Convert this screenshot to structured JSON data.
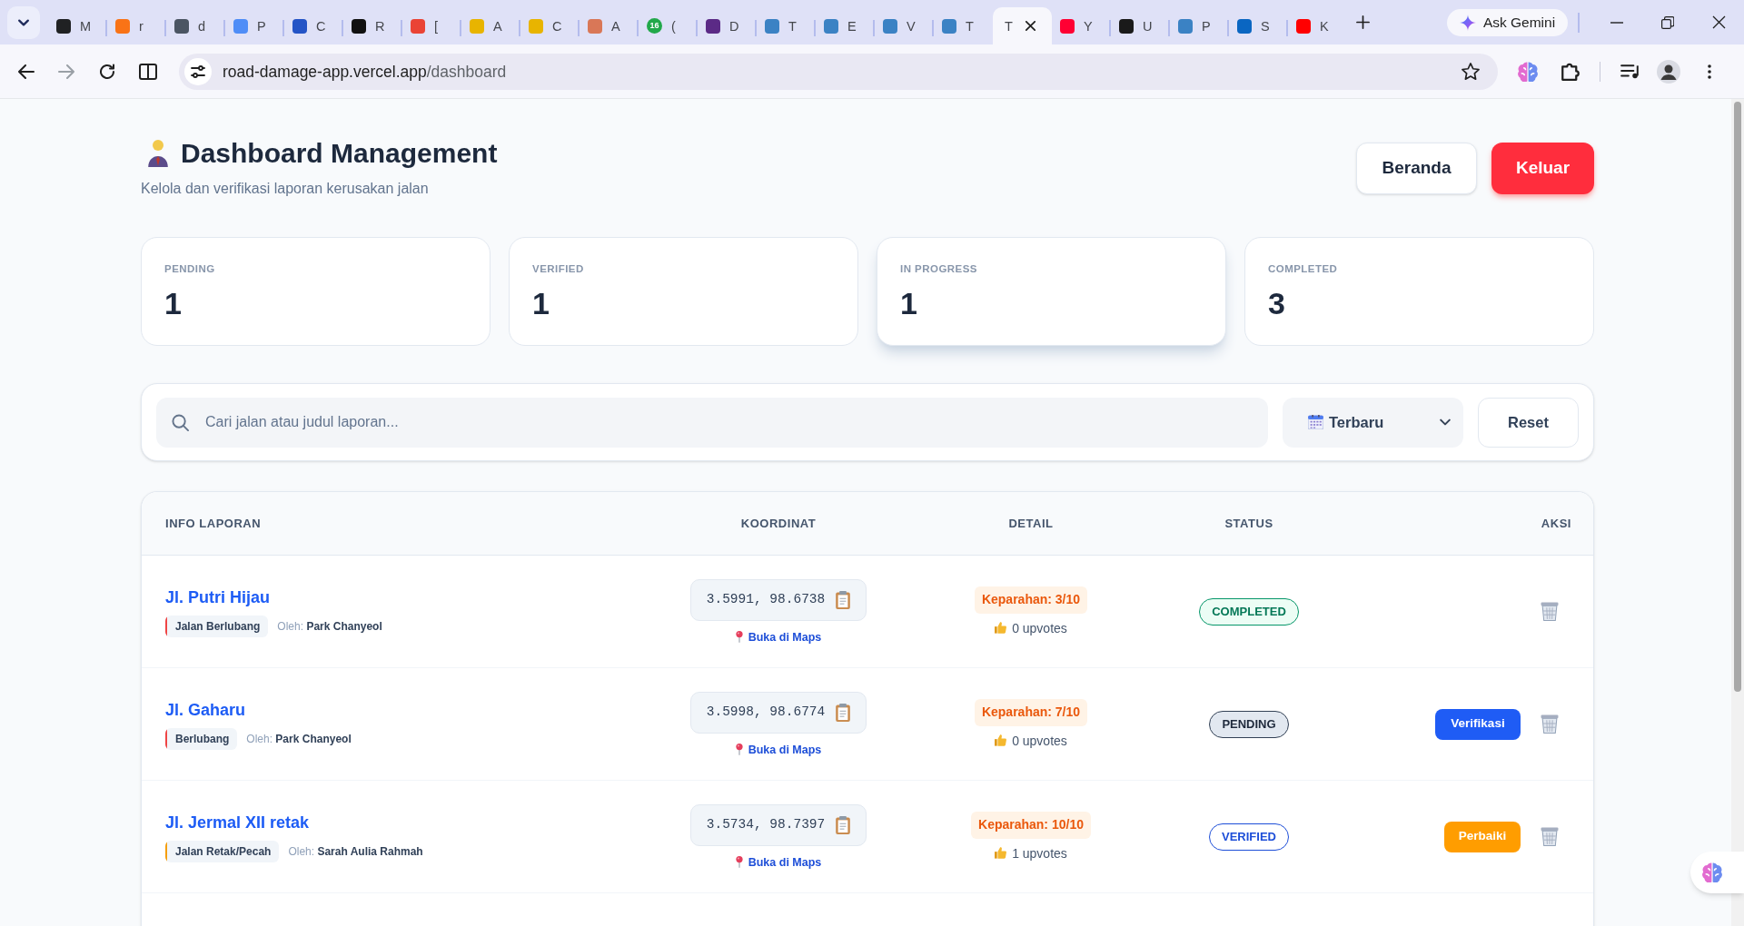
{
  "browser": {
    "tabs": [
      {
        "label": "M",
        "selected": false,
        "color": "#202123"
      },
      {
        "label": "r",
        "selected": false,
        "color": "#f97316"
      },
      {
        "label": "d",
        "selected": false,
        "color": "#4b5563"
      },
      {
        "label": "P",
        "selected": false,
        "color": "#4f8df7"
      },
      {
        "label": "C",
        "selected": false,
        "color": "#2454c6"
      },
      {
        "label": "R",
        "selected": false,
        "color": "#111111"
      },
      {
        "label": "[",
        "selected": false,
        "color": "#ea4335"
      },
      {
        "label": "A",
        "selected": false,
        "color": "#e8b400"
      },
      {
        "label": "C",
        "selected": false,
        "color": "#e8b400"
      },
      {
        "label": "A",
        "selected": false,
        "color": "#d97757"
      },
      {
        "label": "(",
        "selected": false,
        "color": "#22a84a",
        "badge": "16"
      },
      {
        "label": "D",
        "selected": false,
        "color": "#5b2a86"
      },
      {
        "label": "T",
        "selected": false,
        "color": "#3b82c4"
      },
      {
        "label": "E",
        "selected": false,
        "color": "#3b82c4"
      },
      {
        "label": "V",
        "selected": false,
        "color": "#3b82c4"
      },
      {
        "label": "T",
        "selected": false,
        "color": "#3b82c4"
      },
      {
        "label": "T",
        "selected": true
      },
      {
        "label": "Y",
        "selected": false,
        "color": "#ff0033"
      },
      {
        "label": "U",
        "selected": false,
        "color": "#1a1a1a"
      },
      {
        "label": "P",
        "selected": false,
        "color": "#3b82c4"
      },
      {
        "label": "S",
        "selected": false,
        "color": "#0a66c2"
      },
      {
        "label": "K",
        "selected": false,
        "color": "#ff0000"
      }
    ],
    "ask_button": "Ask Gemini",
    "url": {
      "host": "road-damage-app.vercel.app",
      "path": "/dashboard"
    }
  },
  "header": {
    "title": "Dashboard Management",
    "subtitle": "Kelola dan verifikasi laporan kerusakan jalan",
    "buttons": [
      {
        "label": "Beranda",
        "kind": "secondary"
      },
      {
        "label": "Keluar",
        "kind": "danger"
      }
    ]
  },
  "stats": [
    {
      "label": "PENDING",
      "value": "1",
      "hovered": false
    },
    {
      "label": "VERIFIED",
      "value": "1",
      "hovered": false
    },
    {
      "label": "IN PROGRESS",
      "value": "1",
      "hovered": true
    },
    {
      "label": "COMPLETED",
      "value": "3",
      "hovered": false
    }
  ],
  "filters": {
    "search": {
      "placeholder": "Cari jalan atau judul laporan..."
    },
    "sort": {
      "value": "Terbaru"
    },
    "reset": "Reset"
  },
  "table": {
    "columns": [
      "INFO LAPORAN",
      "KOORDINAT",
      "DETAIL",
      "STATUS",
      "AKSI"
    ],
    "rows": [
      {
        "title": "Jl. Putri Hijau",
        "category": {
          "label": "Jalan Berlubang",
          "color": "#ef4444"
        },
        "byline": "Oleh: **Park Chanyeol**",
        "coordinates": "3.5991, 98.6738",
        "maps_link": "Buka di Maps",
        "severity": "Keparahan: 3/10",
        "upvotes": "0 upvotes",
        "status": {
          "label": "COMPLETED",
          "kind": "completed"
        }
      },
      {
        "title": "Jl. Gaharu",
        "category": {
          "label": "Berlubang",
          "color": "#ef4444"
        },
        "byline": "Oleh: **Park Chanyeol**",
        "coordinates": "3.5998, 98.6774",
        "maps_link": "Buka di Maps",
        "severity": "Keparahan: 7/10",
        "upvotes": "0 upvotes",
        "status": {
          "label": "PENDING",
          "kind": "pending"
        },
        "action": {
          "label": "Verifikasi",
          "kind": "verify"
        }
      },
      {
        "title": "Jl. Jermal XII retak",
        "category": {
          "label": "Jalan Retak/Pecah",
          "color": "#f59e0b"
        },
        "byline": "Oleh: **Sarah Aulia Rahmah**",
        "coordinates": "3.5734, 98.7397",
        "maps_link": "Buka di Maps",
        "severity": "Keparahan: 10/10",
        "upvotes": "1 upvotes",
        "status": {
          "label": "VERIFIED",
          "kind": "verified"
        },
        "action": {
          "label": "Perbaiki",
          "kind": "repair"
        }
      }
    ]
  }
}
